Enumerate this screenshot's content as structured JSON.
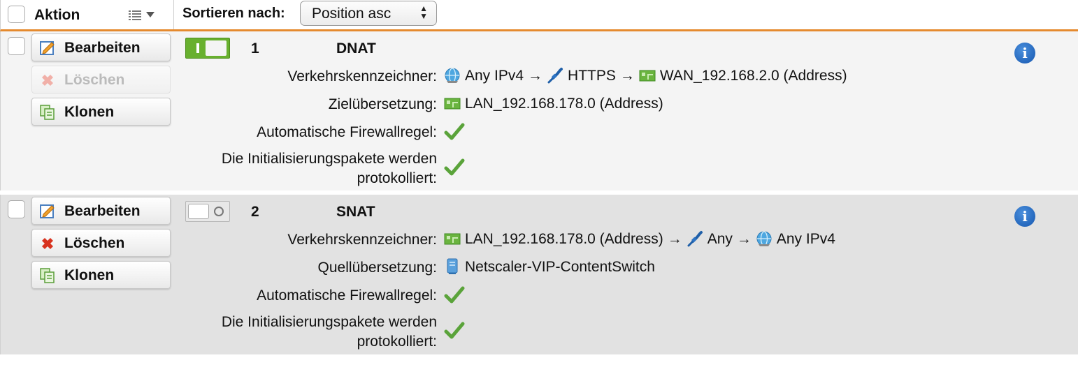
{
  "header": {
    "title": "Aktion",
    "sort_label": "Sortieren nach:",
    "sort_value": "Position asc"
  },
  "rules": [
    {
      "position": "1",
      "type": "DNAT",
      "enabled": true,
      "buttons": {
        "edit": "Bearbeiten",
        "delete": "Löschen",
        "clone": "Klonen"
      },
      "delete_disabled": true,
      "traffic_label": "Verkehrskennzeichner:",
      "traffic": {
        "source": "Any IPv4",
        "service": "HTTPS",
        "destination": "WAN_192.168.2.0 (Address)"
      },
      "translation_label": "Zielübersetzung:",
      "translation": "LAN_192.168.178.0 (Address)",
      "auto_fw_label": "Automatische Firewallregel:",
      "log_label_1": "Die Initialisierungspakete werden",
      "log_label_2": "protokolliert:"
    },
    {
      "position": "2",
      "type": "SNAT",
      "enabled": false,
      "buttons": {
        "edit": "Bearbeiten",
        "delete": "Löschen",
        "clone": "Klonen"
      },
      "delete_disabled": false,
      "traffic_label": "Verkehrskennzeichner:",
      "traffic": {
        "source": "LAN_192.168.178.0 (Address)",
        "service": "Any",
        "destination": "Any IPv4"
      },
      "translation_label": "Quellübersetzung:",
      "translation": "Netscaler-VIP-ContentSwitch",
      "auto_fw_label": "Automatische Firewallregel:",
      "log_label_1": "Die Initialisierungspakete werden",
      "log_label_2": "protokolliert:"
    }
  ],
  "symbols": {
    "arrow": "→",
    "info": "i"
  },
  "colors": {
    "accent": "#e58a2e",
    "toggle_on": "#68b02e",
    "check": "#5aa33a",
    "info": "#1f63b9"
  }
}
